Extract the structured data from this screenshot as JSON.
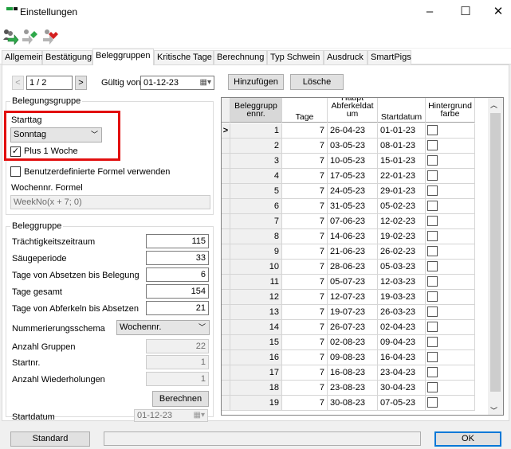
{
  "window": {
    "title": "Einstellungen",
    "min": "–",
    "max": "☐",
    "close": "✕"
  },
  "toolbar": {
    "icons": [
      "people-green-arrow-icon",
      "people-gray-green-arrow-icon",
      "people-red-arrow-icon"
    ]
  },
  "tabs": [
    "Allgemein",
    "Bestätigung",
    "Beleggruppen",
    "Kritische Tage",
    "Berechnung",
    "Typ Schwein",
    "Ausdruck",
    "SmartPigs"
  ],
  "nav": {
    "prev": "<",
    "page": "1 / 2",
    "next": ">",
    "valid_from_label": "Gültig von",
    "valid_from": "01-12-23",
    "add": "Hinzufügen",
    "delete": "Lösche"
  },
  "belegungsgruppe": {
    "title": "Belegungsgruppe",
    "starttag_label": "Starttag",
    "starttag_value": "Sonntag",
    "plus1_label": "Plus 1 Woche",
    "plus1_checked": true,
    "custom_formula_label": "Benutzerdefinierte Formel verwenden",
    "custom_formula_checked": false,
    "formula_label": "Wochennr. Formel",
    "formula_value": "WeekNo(x + 7; 0)"
  },
  "beleggruppe": {
    "title": "Beleggruppe",
    "traechtig_label": "Trächtigkeitszeitraum",
    "traechtig": "115",
    "saeuge_label": "Säugeperiode",
    "saeuge": "33",
    "absetzen_belegung_label": "Tage von Absetzen bis Belegung",
    "absetzen_belegung": "6",
    "gesamt_label": "Tage gesamt",
    "gesamt": "154",
    "abferkeln_absetzen_label": "Tage von Abferkeln bis Absetzen",
    "abferkeln_absetzen": "21",
    "schema_label": "Nummerierungsschema",
    "schema": "Wochennr.",
    "anzahl_gruppen_label": "Anzahl Gruppen",
    "anzahl_gruppen": "22",
    "startnr_label": "Startnr.",
    "startnr": "1",
    "wiederholungen_label": "Anzahl Wiederholungen",
    "wiederholungen": "1",
    "berechnen": "Berechnen",
    "startdatum_label": "Startdatum",
    "startdatum": "01-12-23"
  },
  "grid": {
    "headers": {
      "col1": "Beleggrupp ennr.",
      "col2": "Tage",
      "col3": "Haupt Abferkeldat um",
      "col4": "Startdatum",
      "col5": "Hintergrund farbe"
    },
    "current_marker": ">",
    "rows": [
      {
        "nr": "1",
        "tage": "7",
        "abf": "26-04-23",
        "start": "01-01-23"
      },
      {
        "nr": "2",
        "tage": "7",
        "abf": "03-05-23",
        "start": "08-01-23"
      },
      {
        "nr": "3",
        "tage": "7",
        "abf": "10-05-23",
        "start": "15-01-23"
      },
      {
        "nr": "4",
        "tage": "7",
        "abf": "17-05-23",
        "start": "22-01-23"
      },
      {
        "nr": "5",
        "tage": "7",
        "abf": "24-05-23",
        "start": "29-01-23"
      },
      {
        "nr": "6",
        "tage": "7",
        "abf": "31-05-23",
        "start": "05-02-23"
      },
      {
        "nr": "7",
        "tage": "7",
        "abf": "07-06-23",
        "start": "12-02-23"
      },
      {
        "nr": "8",
        "tage": "7",
        "abf": "14-06-23",
        "start": "19-02-23"
      },
      {
        "nr": "9",
        "tage": "7",
        "abf": "21-06-23",
        "start": "26-02-23"
      },
      {
        "nr": "10",
        "tage": "7",
        "abf": "28-06-23",
        "start": "05-03-23"
      },
      {
        "nr": "11",
        "tage": "7",
        "abf": "05-07-23",
        "start": "12-03-23"
      },
      {
        "nr": "12",
        "tage": "7",
        "abf": "12-07-23",
        "start": "19-03-23"
      },
      {
        "nr": "13",
        "tage": "7",
        "abf": "19-07-23",
        "start": "26-03-23"
      },
      {
        "nr": "14",
        "tage": "7",
        "abf": "26-07-23",
        "start": "02-04-23"
      },
      {
        "nr": "15",
        "tage": "7",
        "abf": "02-08-23",
        "start": "09-04-23"
      },
      {
        "nr": "16",
        "tage": "7",
        "abf": "09-08-23",
        "start": "16-04-23"
      },
      {
        "nr": "17",
        "tage": "7",
        "abf": "16-08-23",
        "start": "23-04-23"
      },
      {
        "nr": "18",
        "tage": "7",
        "abf": "23-08-23",
        "start": "30-04-23"
      },
      {
        "nr": "19",
        "tage": "7",
        "abf": "30-08-23",
        "start": "07-05-23"
      }
    ]
  },
  "footer": {
    "standard": "Standard",
    "ok": "OK"
  },
  "colors": {
    "highlight": "#e20f0f",
    "ok_border": "#0078d7"
  }
}
